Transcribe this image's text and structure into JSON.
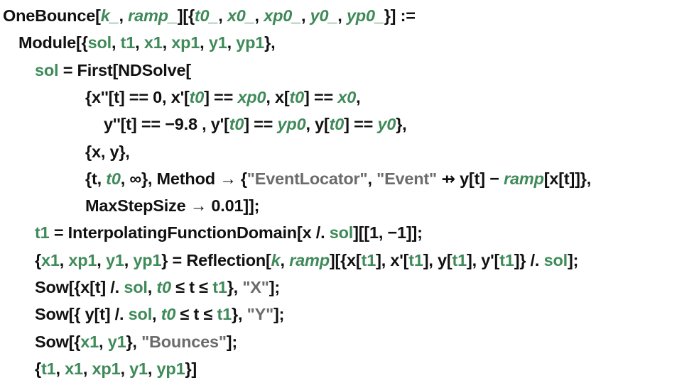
{
  "notebook": {
    "colors": {
      "symbol": "#111111",
      "local_variable": "#3f8a59",
      "pattern_variable": "#3f8a59",
      "string": "#6b6b6b",
      "background": "#ffffff"
    },
    "lines": [
      {
        "indent": 0,
        "tokens": [
          {
            "t": "OneBounce[",
            "k": "plain"
          },
          {
            "t": "k_",
            "k": "pattern"
          },
          {
            "t": ", ",
            "k": "plain"
          },
          {
            "t": "ramp_",
            "k": "pattern"
          },
          {
            "t": "][{",
            "k": "plain"
          },
          {
            "t": "t0_",
            "k": "pattern"
          },
          {
            "t": ", ",
            "k": "plain"
          },
          {
            "t": "x0_",
            "k": "pattern"
          },
          {
            "t": ", ",
            "k": "plain"
          },
          {
            "t": "xp0_",
            "k": "pattern"
          },
          {
            "t": ", ",
            "k": "plain"
          },
          {
            "t": "y0_",
            "k": "pattern"
          },
          {
            "t": ", ",
            "k": "plain"
          },
          {
            "t": "yp0_",
            "k": "pattern"
          },
          {
            "t": "}] :=",
            "k": "plain"
          }
        ]
      },
      {
        "indent": 1,
        "tokens": [
          {
            "t": "Module[{",
            "k": "plain"
          },
          {
            "t": "sol",
            "k": "local"
          },
          {
            "t": ", ",
            "k": "plain"
          },
          {
            "t": "t1",
            "k": "local"
          },
          {
            "t": ", ",
            "k": "plain"
          },
          {
            "t": "x1",
            "k": "local"
          },
          {
            "t": ", ",
            "k": "plain"
          },
          {
            "t": "xp1",
            "k": "local"
          },
          {
            "t": ", ",
            "k": "plain"
          },
          {
            "t": "y1",
            "k": "local"
          },
          {
            "t": ", ",
            "k": "plain"
          },
          {
            "t": "yp1",
            "k": "local"
          },
          {
            "t": "},",
            "k": "plain"
          }
        ]
      },
      {
        "indent": 2,
        "tokens": [
          {
            "t": "sol",
            "k": "local"
          },
          {
            "t": " = First[NDSolve[",
            "k": "plain"
          }
        ]
      },
      {
        "indent": 3,
        "tokens": [
          {
            "t": "{x''[t] == 0, x'[",
            "k": "plain"
          },
          {
            "t": "t0",
            "k": "pattern"
          },
          {
            "t": "] == ",
            "k": "plain"
          },
          {
            "t": "xp0",
            "k": "pattern"
          },
          {
            "t": ", x[",
            "k": "plain"
          },
          {
            "t": "t0",
            "k": "pattern"
          },
          {
            "t": "] == ",
            "k": "plain"
          },
          {
            "t": "x0",
            "k": "pattern"
          },
          {
            "t": ",",
            "k": "plain"
          }
        ]
      },
      {
        "indent": 4,
        "tokens": [
          {
            "t": "y''[t] == −9.8 , y'[",
            "k": "plain"
          },
          {
            "t": "t0",
            "k": "pattern"
          },
          {
            "t": "] == ",
            "k": "plain"
          },
          {
            "t": "yp0",
            "k": "pattern"
          },
          {
            "t": ", y[",
            "k": "plain"
          },
          {
            "t": "t0",
            "k": "pattern"
          },
          {
            "t": "] == ",
            "k": "plain"
          },
          {
            "t": "y0",
            "k": "pattern"
          },
          {
            "t": "},",
            "k": "plain"
          }
        ]
      },
      {
        "indent": 3,
        "tokens": [
          {
            "t": "{x, y},",
            "k": "plain"
          }
        ]
      },
      {
        "indent": 3,
        "tokens": [
          {
            "t": "{t, ",
            "k": "plain"
          },
          {
            "t": "t0",
            "k": "pattern"
          },
          {
            "t": ", ∞}, Method → {",
            "k": "plain"
          },
          {
            "t": "\"EventLocator\"",
            "k": "string"
          },
          {
            "t": ", ",
            "k": "plain"
          },
          {
            "t": "\"Event\"",
            "k": "string"
          },
          {
            "t": " ⇸ y[t] − ",
            "k": "plain"
          },
          {
            "t": "ramp",
            "k": "pattern"
          },
          {
            "t": "[x[t]]},",
            "k": "plain"
          }
        ]
      },
      {
        "indent": 3,
        "tokens": [
          {
            "t": "MaxStepSize → 0.01]];",
            "k": "plain"
          }
        ]
      },
      {
        "indent": 2,
        "tokens": [
          {
            "t": "t1",
            "k": "local"
          },
          {
            "t": " = InterpolatingFunctionDomain[x /. ",
            "k": "plain"
          },
          {
            "t": "sol",
            "k": "local"
          },
          {
            "t": "][[1, −1]];",
            "k": "plain"
          }
        ]
      },
      {
        "indent": 2,
        "tokens": [
          {
            "t": "{",
            "k": "plain"
          },
          {
            "t": "x1",
            "k": "local"
          },
          {
            "t": ", ",
            "k": "plain"
          },
          {
            "t": "xp1",
            "k": "local"
          },
          {
            "t": ", ",
            "k": "plain"
          },
          {
            "t": "y1",
            "k": "local"
          },
          {
            "t": ", ",
            "k": "plain"
          },
          {
            "t": "yp1",
            "k": "local"
          },
          {
            "t": "} = Reflection[",
            "k": "plain"
          },
          {
            "t": "k",
            "k": "pattern"
          },
          {
            "t": ", ",
            "k": "plain"
          },
          {
            "t": "ramp",
            "k": "pattern"
          },
          {
            "t": "][{x[",
            "k": "plain"
          },
          {
            "t": "t1",
            "k": "local"
          },
          {
            "t": "], x'[",
            "k": "plain"
          },
          {
            "t": "t1",
            "k": "local"
          },
          {
            "t": "], y[",
            "k": "plain"
          },
          {
            "t": "t1",
            "k": "local"
          },
          {
            "t": "], y'[",
            "k": "plain"
          },
          {
            "t": "t1",
            "k": "local"
          },
          {
            "t": "]} /. ",
            "k": "plain"
          },
          {
            "t": "sol",
            "k": "local"
          },
          {
            "t": "];",
            "k": "plain"
          }
        ]
      },
      {
        "indent": 2,
        "tokens": [
          {
            "t": "Sow[{x[t] /. ",
            "k": "plain"
          },
          {
            "t": "sol",
            "k": "local"
          },
          {
            "t": ", ",
            "k": "plain"
          },
          {
            "t": "t0",
            "k": "pattern"
          },
          {
            "t": " ≤ t ≤ ",
            "k": "plain"
          },
          {
            "t": "t1",
            "k": "local"
          },
          {
            "t": "}, ",
            "k": "plain"
          },
          {
            "t": "\"X\"",
            "k": "string"
          },
          {
            "t": "];",
            "k": "plain"
          }
        ]
      },
      {
        "indent": 2,
        "tokens": [
          {
            "t": "Sow[{ y[t] /. ",
            "k": "plain"
          },
          {
            "t": "sol",
            "k": "local"
          },
          {
            "t": ", ",
            "k": "plain"
          },
          {
            "t": "t0",
            "k": "pattern"
          },
          {
            "t": " ≤ t ≤ ",
            "k": "plain"
          },
          {
            "t": "t1",
            "k": "local"
          },
          {
            "t": "}, ",
            "k": "plain"
          },
          {
            "t": "\"Y\"",
            "k": "string"
          },
          {
            "t": "];",
            "k": "plain"
          }
        ]
      },
      {
        "indent": 2,
        "tokens": [
          {
            "t": "Sow[{",
            "k": "plain"
          },
          {
            "t": "x1",
            "k": "local"
          },
          {
            "t": ", ",
            "k": "plain"
          },
          {
            "t": "y1",
            "k": "local"
          },
          {
            "t": "}, ",
            "k": "plain"
          },
          {
            "t": "\"Bounces\"",
            "k": "string"
          },
          {
            "t": "];",
            "k": "plain"
          }
        ]
      },
      {
        "indent": 2,
        "tokens": [
          {
            "t": "{",
            "k": "plain"
          },
          {
            "t": "t1",
            "k": "local"
          },
          {
            "t": ", ",
            "k": "plain"
          },
          {
            "t": "x1",
            "k": "local"
          },
          {
            "t": ", ",
            "k": "plain"
          },
          {
            "t": "xp1",
            "k": "local"
          },
          {
            "t": ", ",
            "k": "plain"
          },
          {
            "t": "y1",
            "k": "local"
          },
          {
            "t": ", ",
            "k": "plain"
          },
          {
            "t": "yp1",
            "k": "local"
          },
          {
            "t": "}]",
            "k": "plain"
          }
        ]
      }
    ]
  }
}
